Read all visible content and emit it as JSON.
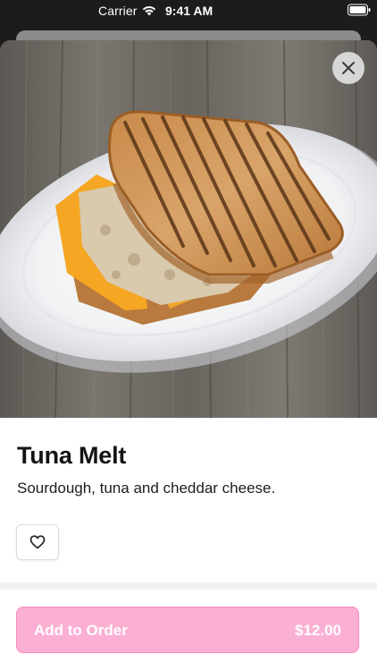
{
  "status_bar": {
    "carrier": "Carrier",
    "time": "9:41 AM",
    "icons": [
      "wifi-icon",
      "battery-icon"
    ]
  },
  "header": {
    "close_icon": "close-icon"
  },
  "item": {
    "name": "Tuna Melt",
    "description": "Sourdough, tuna and cheddar cheese.",
    "image_icon": "sandwich-photo"
  },
  "actions": {
    "favorite_icon": "heart-icon",
    "add_label": "Add to Order",
    "price": "$12.00"
  },
  "colors": {
    "accent": "#fbb0d3",
    "accent_border": "#f58cc0",
    "text_primary": "#141414"
  }
}
